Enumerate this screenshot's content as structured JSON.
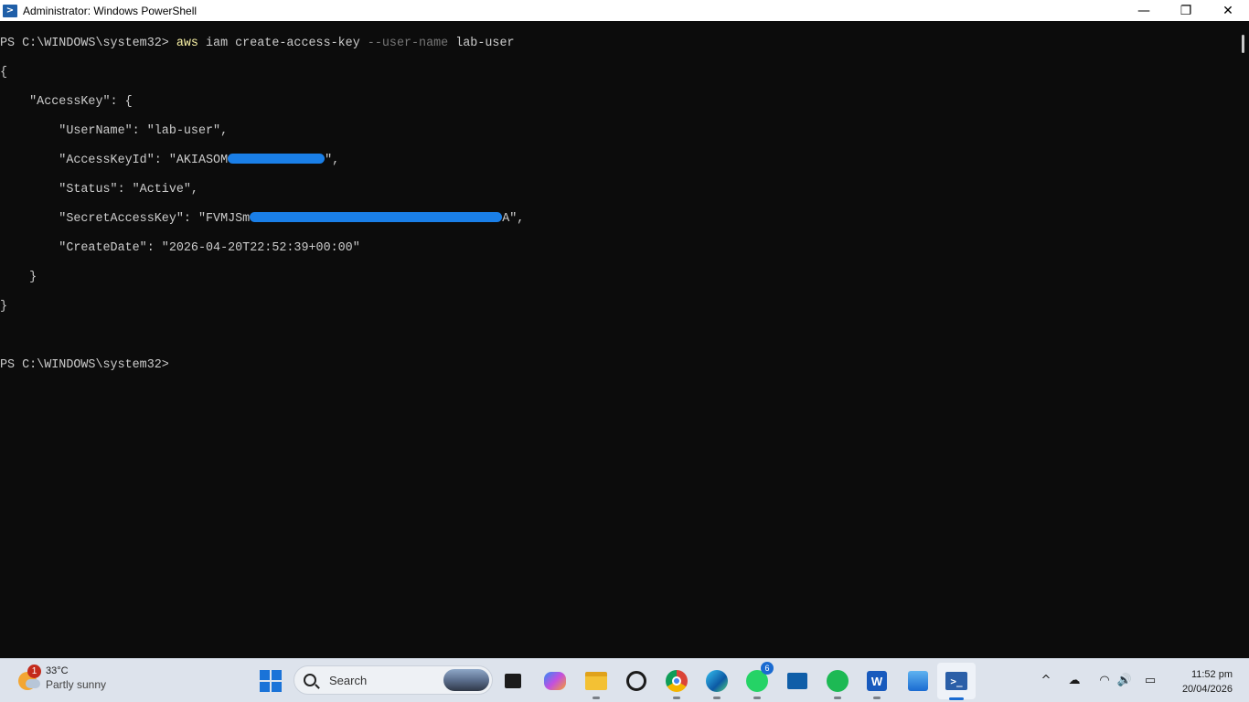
{
  "window": {
    "title": "Administrator: Windows PowerShell",
    "minimize_glyph": "—",
    "maximize_glyph": "❐",
    "close_glyph": "✕"
  },
  "console": {
    "prompt": "PS C:\\WINDOWS\\system32> ",
    "command_exe": "aws",
    "command_args_1": " iam create-access-key ",
    "command_param": "--user-name",
    "command_args_2": " lab-user",
    "output": {
      "l1": "{",
      "l2": "    \"AccessKey\": {",
      "l3": "        \"UserName\": \"lab-user\",",
      "l4_prefix": "        \"AccessKeyId\": \"AKIASOM",
      "l4_suffix": "\",",
      "l5": "        \"Status\": \"Active\",",
      "l6_prefix": "        \"SecretAccessKey\": \"FVMJSm",
      "l6_suffix": "A\",",
      "l7": "        \"CreateDate\": \"2026-04-20T22:52:39+00:00\"",
      "l8": "    }",
      "l9": "}"
    },
    "prompt_2": "PS C:\\WINDOWS\\system32>"
  },
  "taskbar": {
    "weather": {
      "badge": "1",
      "temp": "33°C",
      "desc": "Partly sunny"
    },
    "search_placeholder": "Search",
    "apps": [
      {
        "name": "task-view-icon",
        "glyph": "▣"
      },
      {
        "name": "copilot-icon",
        "glyph": "✿"
      },
      {
        "name": "file-explorer-icon",
        "glyph": "📁"
      },
      {
        "name": "chatgpt-icon",
        "glyph": "✺"
      },
      {
        "name": "chrome-icon",
        "glyph": "◉"
      },
      {
        "name": "edge-icon",
        "glyph": "◐"
      },
      {
        "name": "whatsapp-icon",
        "glyph": "✆",
        "badge": "6"
      },
      {
        "name": "remote-desktop-icon",
        "glyph": "▤"
      },
      {
        "name": "spotify-icon",
        "glyph": "≋"
      },
      {
        "name": "word-icon",
        "glyph": "W"
      },
      {
        "name": "photos-icon",
        "glyph": "▲"
      },
      {
        "name": "powershell-icon",
        "glyph": ">_"
      }
    ],
    "tray": {
      "chevron": "^",
      "onedrive": "☁",
      "wifi": "◠",
      "volume": "🔊",
      "battery": "▭"
    },
    "clock": {
      "time": "11:52 pm",
      "date": "20/04/2026"
    }
  },
  "colors": {
    "console_bg": "#0c0c0c",
    "console_text": "#cccccc",
    "command_yellow": "#f9f1a5",
    "param_gray": "#767676",
    "redaction_blue": "#1a7fe8",
    "taskbar_bg": "#dde3ec",
    "accent": "#1a6bd1"
  }
}
